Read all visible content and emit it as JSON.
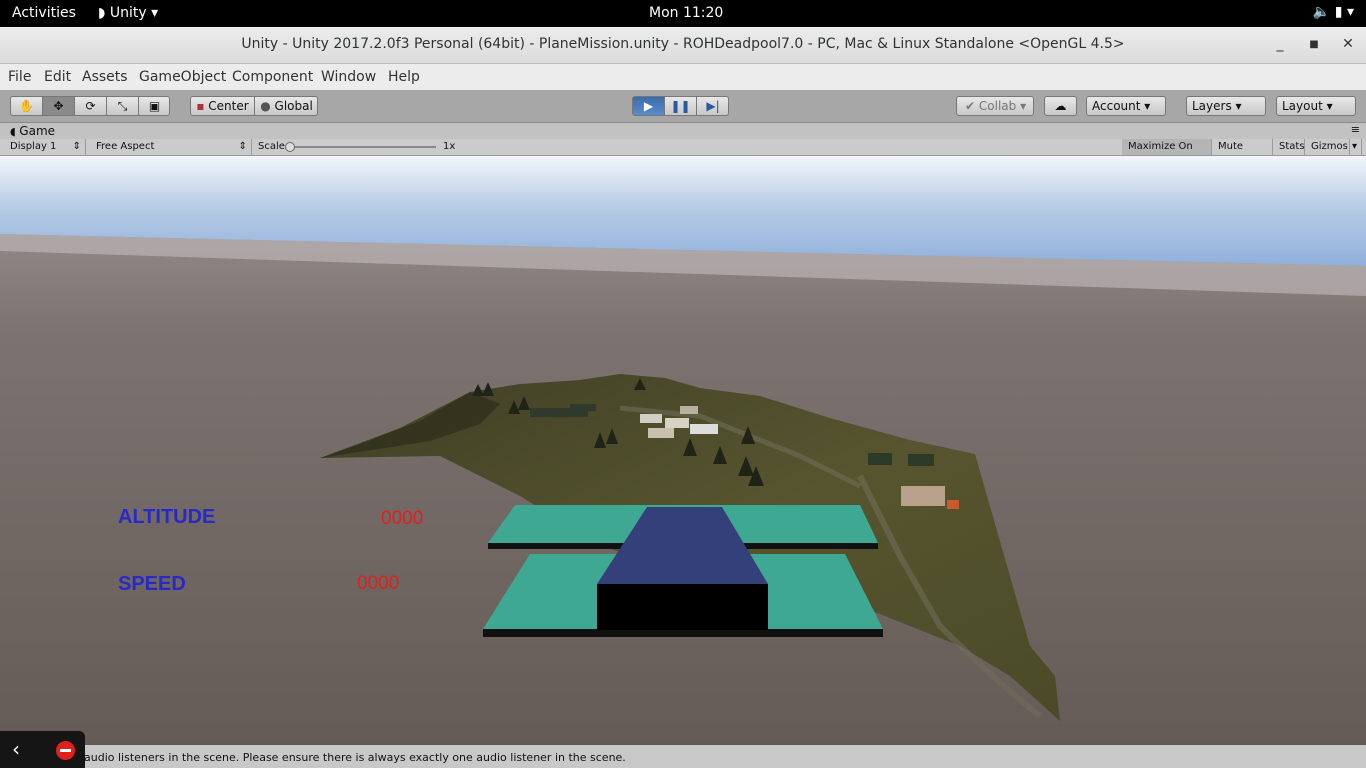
{
  "topbar": {
    "activities": "Activities",
    "app_menu": "Unity",
    "clock": "Mon 11:20"
  },
  "window": {
    "title": "Unity - Unity 2017.2.0f3 Personal (64bit) - PlaneMission.unity - ROHDeadpool7.0 - PC, Mac & Linux Standalone <OpenGL 4.5>"
  },
  "menu": [
    "File",
    "Edit",
    "Assets",
    "GameObject",
    "Component",
    "Window",
    "Help"
  ],
  "toolbar": {
    "pivot": "Center",
    "space": "Global",
    "collab": "Collab",
    "account": "Account",
    "layers": "Layers",
    "layout": "Layout"
  },
  "game_tab": {
    "label": "Game"
  },
  "game_bar": {
    "display": "Display 1",
    "aspect": "Free Aspect",
    "scale_label": "Scale",
    "scale_value": "1x",
    "maximize": "Maximize On Play",
    "mute": "Mute Audio",
    "stats": "Stats",
    "gizmos": "Gizmos"
  },
  "hud": {
    "altitude_label": "ALTITUDE",
    "altitude_value": "0000",
    "speed_label": "SPEED",
    "speed_value": "0000"
  },
  "status": {
    "message": "audio listeners in the scene. Please ensure there is always exactly one audio listener in the scene."
  },
  "colors": {
    "hud_label": "#2929c9",
    "hud_value": "#e0201a",
    "wing": "#3fa893",
    "fuselage": "#33407a"
  }
}
